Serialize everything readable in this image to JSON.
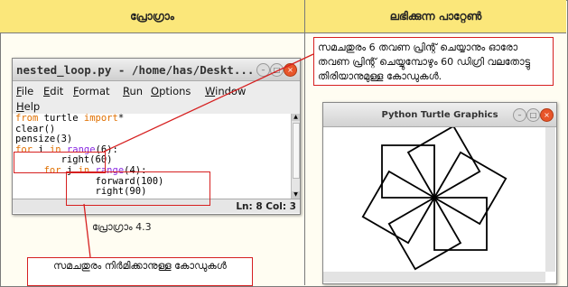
{
  "headers": {
    "left": "പ്രോഗ്രാം",
    "right": "ലഭിക്കുന്ന പാറ്റേൺ"
  },
  "idle": {
    "title": "nested_loop.py - /home/has/Deskt...",
    "menu": [
      "File",
      "Edit",
      "Format",
      "Run",
      "Options",
      "Window",
      "Help"
    ],
    "code_lines": [
      [
        {
          "t": "from",
          "c": "kw"
        },
        {
          "t": " turtle ",
          "c": ""
        },
        {
          "t": "import",
          "c": "kw"
        },
        {
          "t": "*",
          "c": ""
        }
      ],
      [
        {
          "t": "clear()",
          "c": ""
        }
      ],
      [
        {
          "t": "pensize(3)",
          "c": ""
        }
      ],
      [
        {
          "t": "for",
          "c": "kw"
        },
        {
          "t": " i ",
          "c": ""
        },
        {
          "t": "in",
          "c": "kw"
        },
        {
          "t": " ",
          "c": ""
        },
        {
          "t": "range",
          "c": "bi"
        },
        {
          "t": "(6):",
          "c": ""
        }
      ],
      [
        {
          "t": "        right(60)",
          "c": ""
        }
      ],
      [
        {
          "t": "     ",
          "c": ""
        },
        {
          "t": "for",
          "c": "kw"
        },
        {
          "t": " j ",
          "c": ""
        },
        {
          "t": "in",
          "c": "kw"
        },
        {
          "t": " ",
          "c": ""
        },
        {
          "t": "range",
          "c": "bi"
        },
        {
          "t": "(4):",
          "c": ""
        }
      ],
      [
        {
          "t": "              forward(100)",
          "c": ""
        }
      ],
      [
        {
          "t": "              right(90)",
          "c": ""
        }
      ]
    ],
    "status": "Ln: 8  Col: 3"
  },
  "caption": "പ്രോഗ്രാം 4.3",
  "description": "സമചതുരം 6 തവണ പ്രിന്റ് ചെയ്യാനും ഓരോ തവണ പ്രിന്റ് ചെയ്യുമ്പോഴും 60 ഡിഗ്രി വലതോട്ടു തിരിയാനുമുള്ള കോഡുകൾ.",
  "note": "സമചതുരം നിർമിക്കാനുള്ള കോഡുകൾ",
  "turtle": {
    "title": "Python Turtle Graphics",
    "squares": 6,
    "turn_deg": 60,
    "side": 100
  },
  "colors": {
    "header_bg": "#fbe77a",
    "accent_red": "#d62020",
    "keyword": "#e07000",
    "builtin": "#8a2be2"
  }
}
